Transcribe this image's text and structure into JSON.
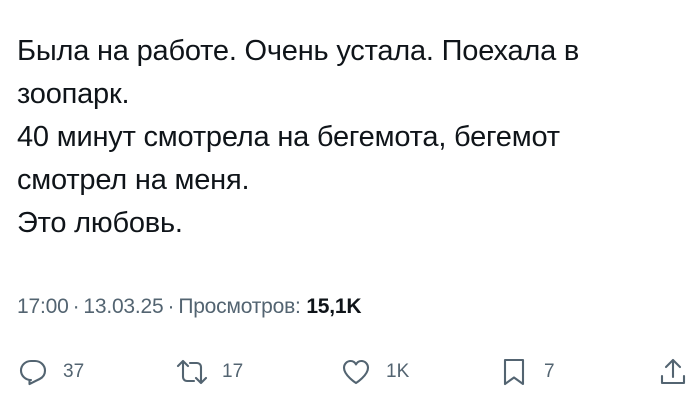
{
  "tweet": {
    "lines": [
      "Была на работе. Очень устала. Поехала в",
      "зоопарк.",
      "40 минут смотрела на бегемота, бегемот",
      "смотрел на меня.",
      "Это любовь."
    ],
    "time": "17:00",
    "date": "13.03.25",
    "separator": "·",
    "views_label": "Просмотров:",
    "views_count": "15,1K"
  },
  "actions": {
    "reply": {
      "icon": "reply-icon",
      "count": "37"
    },
    "retweet": {
      "icon": "retweet-icon",
      "count": "17"
    },
    "like": {
      "icon": "heart-icon",
      "count": "1K"
    },
    "bookmark": {
      "icon": "bookmark-icon",
      "count": "7"
    },
    "share": {
      "icon": "share-icon"
    }
  },
  "colors": {
    "text": "#0f1419",
    "secondary": "#536471",
    "background": "#ffffff"
  }
}
